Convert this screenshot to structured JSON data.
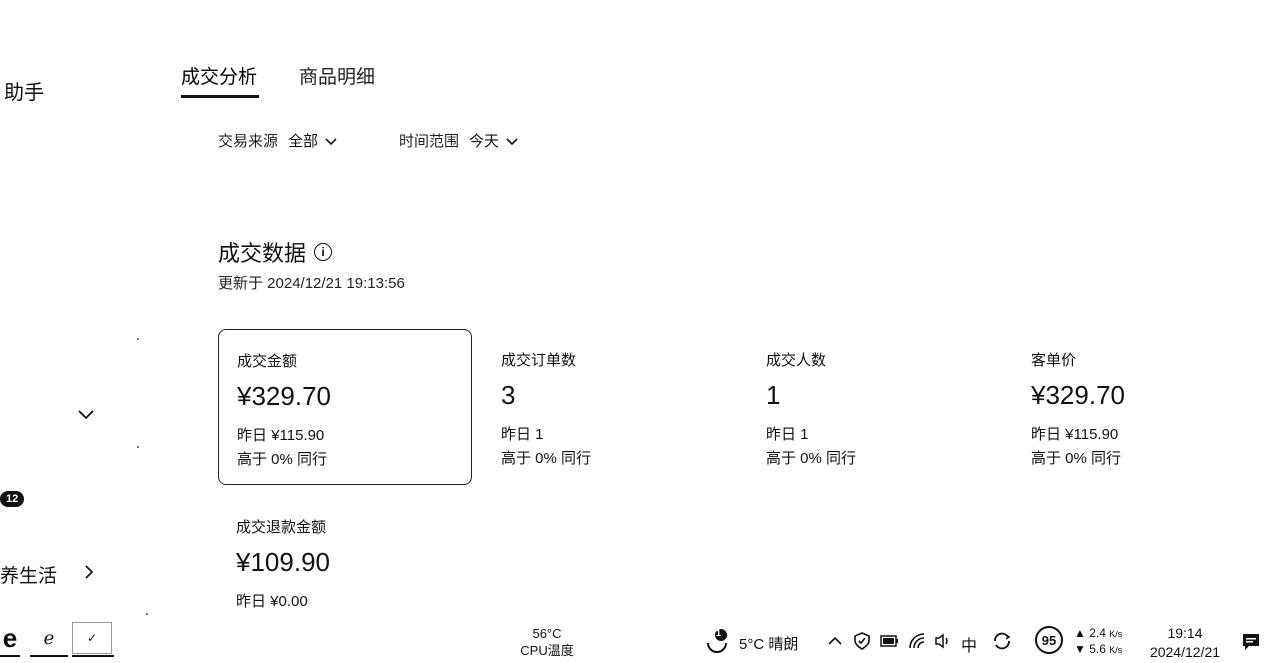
{
  "sidebar": {
    "title": "助手",
    "badge": "12",
    "life_label": "养生活"
  },
  "tabs": [
    {
      "label": "成交分析",
      "active": true
    },
    {
      "label": "商品明细",
      "active": false
    }
  ],
  "filters": {
    "source_label": "交易来源",
    "source_value": "全部",
    "time_label": "时间范围",
    "time_value": "今天"
  },
  "section": {
    "title": "成交数据",
    "updated": "更新于 2024/12/21 19:13:56"
  },
  "metrics": [
    {
      "title": "成交金额",
      "value": "¥329.70",
      "yesterday": "昨日 ¥115.90",
      "compare": "高于 0% 同行",
      "selected": true
    },
    {
      "title": "成交订单数",
      "value": "3",
      "yesterday": "昨日 1",
      "compare": "高于 0% 同行"
    },
    {
      "title": "成交人数",
      "value": "1",
      "yesterday": "昨日 1",
      "compare": "高于 0% 同行"
    },
    {
      "title": "客单价",
      "value": "¥329.70",
      "yesterday": "昨日 ¥115.90",
      "compare": "高于 0% 同行"
    },
    {
      "title": "成交退款金额",
      "value": "¥109.90",
      "yesterday": "昨日 ¥0.00"
    }
  ],
  "taskbar": {
    "cpu_temp": "56°C",
    "cpu_label": "CPU温度",
    "weather_badge": "1",
    "weather": "5°C  晴朗",
    "ime": "中",
    "battery_score": "95",
    "net_up": "2.4",
    "net_down": "5.6",
    "net_unit": "K/s",
    "time": "19:14",
    "date": "2024/12/21"
  }
}
